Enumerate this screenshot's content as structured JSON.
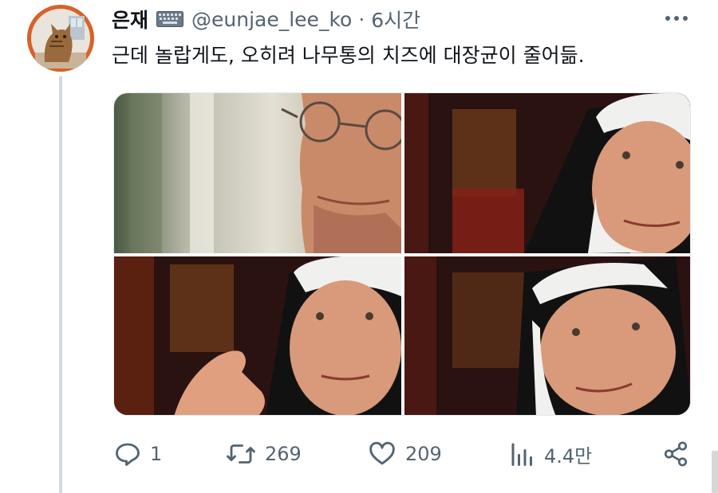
{
  "author": {
    "display_name": "은재",
    "badge_icon": "keyboard-icon",
    "handle": "@eunjae_lee_ko",
    "separator": "·",
    "time": "6시간"
  },
  "tweet": {
    "text": "근데 놀랍게도, 오히려 나무통의 치즈에 대장균이 줄어듦."
  },
  "media": {
    "images": [
      {
        "description_icon": "man-with-glasses-image"
      },
      {
        "description_icon": "nun-speaking-image"
      },
      {
        "description_icon": "nun-gesturing-image"
      },
      {
        "description_icon": "nun-smiling-image"
      }
    ]
  },
  "actions": {
    "reply_count": "1",
    "retweet_count": "269",
    "like_count": "209",
    "views_count": "4.4만"
  },
  "colors": {
    "text_primary": "#0f1419",
    "text_secondary": "#536471",
    "avatar_ring": "#d8622a"
  }
}
